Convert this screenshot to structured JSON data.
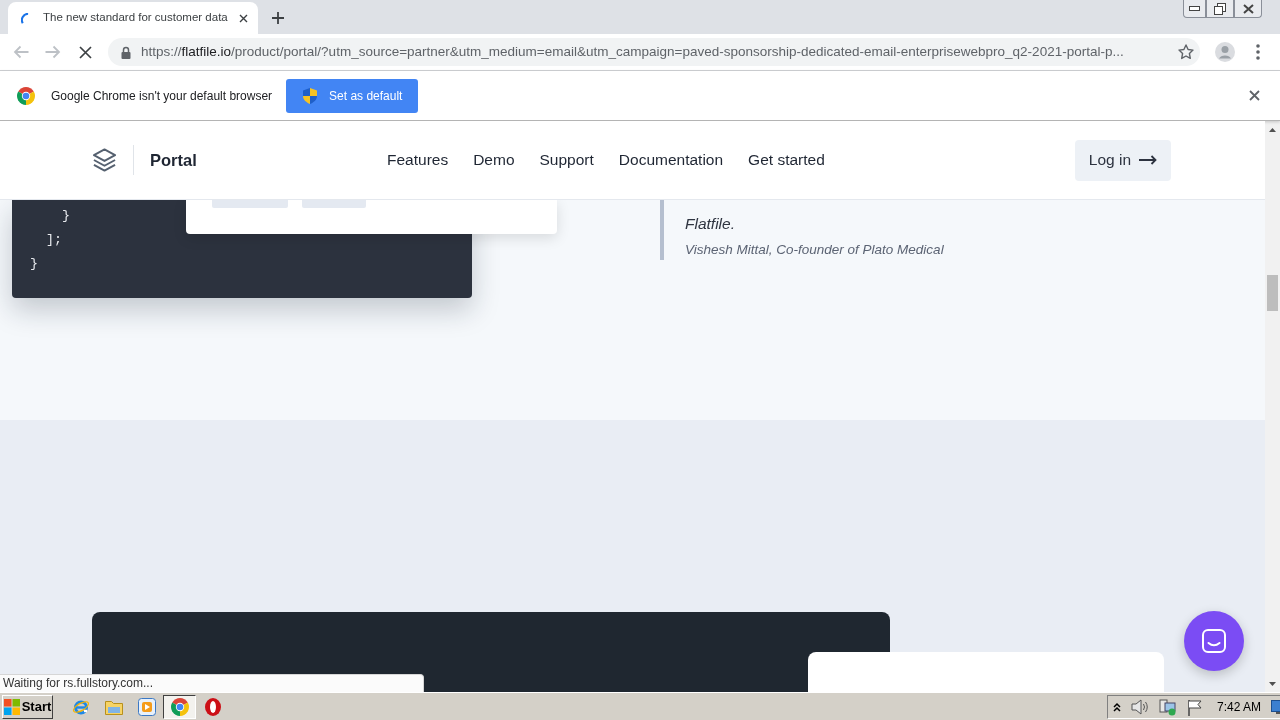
{
  "browser": {
    "tabs": [
      {
        "title": "The new standard for customer data",
        "selected": true
      }
    ],
    "nav_buttons": [
      {
        "kind": "back",
        "disabled": true
      },
      {
        "kind": "forward",
        "disabled": true
      },
      {
        "kind": "stop",
        "disabled": false
      }
    ],
    "url": {
      "scheme": "https://",
      "domain": "flatfile.io",
      "path": "/product/portal/?utm_source=partner&utm_medium=email&utm_campaign=paved-sponsorship-dedicated-email-enterprisewebpro_q2-2021-portal-p..."
    }
  },
  "infobar": {
    "message": "Google Chrome isn't your default browser",
    "button": "Set as default"
  },
  "site_header": {
    "brand": "Portal",
    "nav": [
      "Features",
      "Demo",
      "Support",
      "Documentation",
      "Get started"
    ],
    "login": "Log in"
  },
  "code_block": {
    "lines": [
      "    }",
      "  ];",
      "}"
    ]
  },
  "quote": {
    "text": "Flatfile.",
    "attribution": "Vishesh Mittal, Co-founder of Plato Medical"
  },
  "status_bubble": {
    "text": "Waiting for rs.fullstory.com..."
  },
  "taskbar": {
    "start": "Start",
    "apps": [
      {
        "kind": "ie",
        "selected": false
      },
      {
        "kind": "explorer",
        "selected": false
      },
      {
        "kind": "media",
        "selected": false
      },
      {
        "kind": "chrome",
        "selected": true
      },
      {
        "kind": "opera",
        "selected": false
      }
    ],
    "clock": "7:42 AM"
  }
}
